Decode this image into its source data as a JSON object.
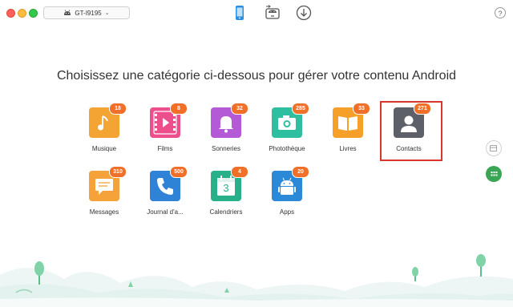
{
  "window": {
    "device_name": "GT-I9195",
    "help_label": "?"
  },
  "toolbar": {
    "icons": [
      "phone-icon",
      "android-transfer-icon",
      "download-icon"
    ]
  },
  "main": {
    "headline": "Choisissez une catégorie ci-dessous pour gérer votre contenu Android",
    "categories": [
      {
        "label": "Musique",
        "count": "18",
        "icon": "music-icon",
        "color": "#f4a433"
      },
      {
        "label": "Films",
        "count": "8",
        "icon": "film-icon",
        "color": "#ec4f8c"
      },
      {
        "label": "Sonneries",
        "count": "32",
        "icon": "bell-icon",
        "color": "#b45ad6"
      },
      {
        "label": "Photothèque",
        "count": "285",
        "icon": "camera-icon",
        "color": "#2ebfa0"
      },
      {
        "label": "Livres",
        "count": "33",
        "icon": "book-icon",
        "color": "#f6a02a"
      },
      {
        "label": "Contacts",
        "count": "271",
        "icon": "contact-icon",
        "color": "#5d6068"
      },
      {
        "label": "Messages",
        "count": "310",
        "icon": "message-icon",
        "color": "#f5a23a"
      },
      {
        "label": "Journal d'a...",
        "count": "500",
        "icon": "phone-call-icon",
        "color": "#2f83d6"
      },
      {
        "label": "Calendriers",
        "count": "4",
        "icon": "calendar-icon",
        "color": "#27b08a",
        "day": "3"
      },
      {
        "label": "Apps",
        "count": "20",
        "icon": "android-app-icon",
        "color": "#2c89d8"
      }
    ],
    "selected": "Contacts"
  },
  "colors": {
    "badge": "#f0702a",
    "selection": "#d9362b",
    "accent_green": "#3aa555"
  }
}
